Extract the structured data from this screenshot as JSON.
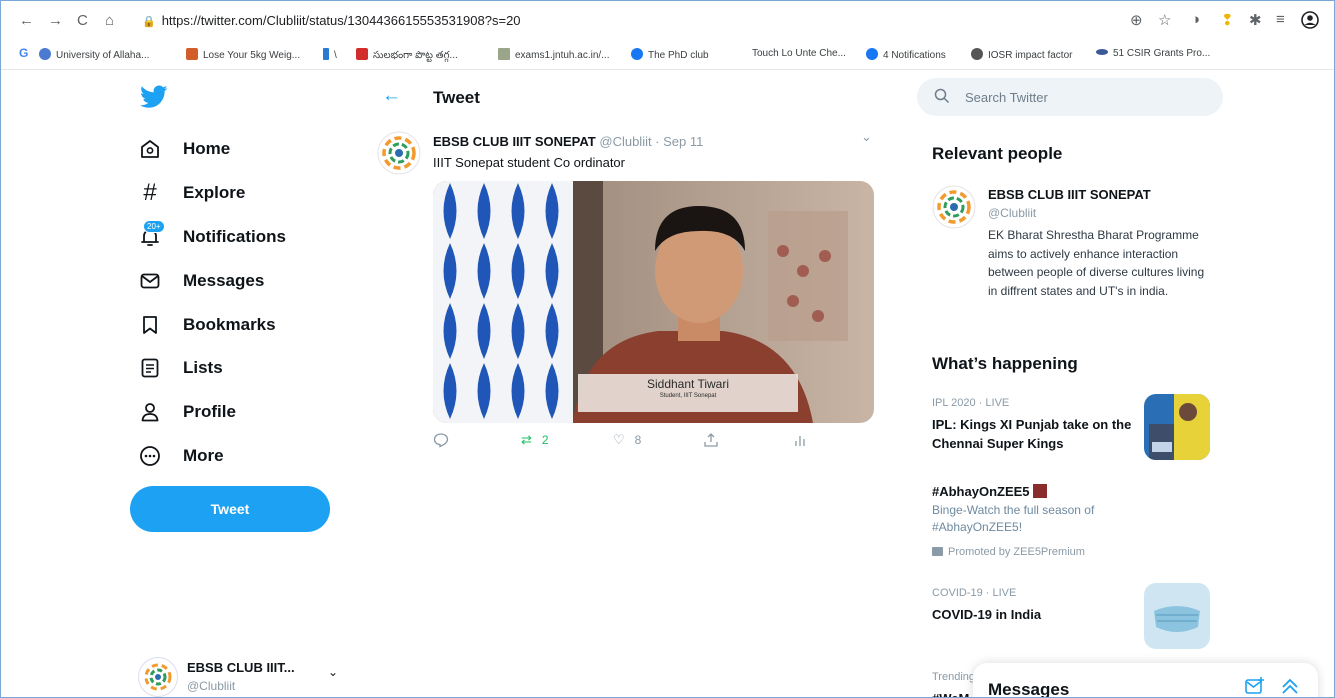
{
  "browser": {
    "url": "https://twitter.com/Clubliit/status/1304436615553531908?s=20",
    "bookmarks": [
      {
        "label": "University of Allaha...",
        "color": "#4a7bd1"
      },
      {
        "label": "Lose Your 5kg Weig...",
        "color": "#d35d2a"
      },
      {
        "label": "\\",
        "color": "#2a7ad1"
      },
      {
        "label": "సులభంగా పొట్ట తగ్గ...",
        "color": "#d22c2c"
      },
      {
        "label": "exams1.jntuh.ac.in/...",
        "color": "#9aa58a"
      },
      {
        "label": "The PhD club",
        "color": "#1877f2"
      },
      {
        "label": "Touch Lo Unte Che...",
        "color": "#ffffff"
      },
      {
        "label": "4 Notifications",
        "color": "#1877f2"
      },
      {
        "label": "IOSR impact factor",
        "color": "#555555"
      },
      {
        "label": "51 CSIR Grants Pro...",
        "color": "#3b5998"
      }
    ]
  },
  "nav": {
    "items": [
      {
        "label": "Home",
        "icon": "home-icon"
      },
      {
        "label": "Explore",
        "icon": "hashtag-icon"
      },
      {
        "label": "Notifications",
        "icon": "bell-icon",
        "badge": "20+"
      },
      {
        "label": "Messages",
        "icon": "envelope-icon"
      },
      {
        "label": "Bookmarks",
        "icon": "bookmark-icon"
      },
      {
        "label": "Lists",
        "icon": "list-icon"
      },
      {
        "label": "Profile",
        "icon": "person-icon"
      },
      {
        "label": "More",
        "icon": "more-icon"
      }
    ],
    "tweet_button": "Tweet",
    "account": {
      "name": "EBSB CLUB IIIT...",
      "handle": "@Clubliit"
    }
  },
  "main": {
    "page_title": "Tweet",
    "tweet": {
      "author": "EBSB CLUB IIIT SONEPAT",
      "meta": "@Clubliit · Sep 11",
      "text": "IIIT Sonepat student Co ordinator",
      "video_name": "Siddhant Tiwari",
      "video_role": "Student, IIIT Sonepat",
      "retweets": "2",
      "likes": "8"
    }
  },
  "sidebar": {
    "search_placeholder": "Search Twitter",
    "relevant_title": "Relevant people",
    "relevant": {
      "name": "EBSB CLUB IIIT SONEPAT",
      "handle": "@Clubliit",
      "bio": "EK Bharat Shrestha Bharat Programme aims to actively enhance interaction between people of diverse cultures living in diffrent states and UT's in india."
    },
    "happening_title": "What’s happening",
    "trends": [
      {
        "meta": "IPL 2020 · LIVE",
        "title": "IPL: Kings XI Punjab take on the Chennai Super Kings"
      },
      {
        "title": "#AbhayOnZEE5",
        "desc": "Binge-Watch the full season of #AbhayOnZEE5!",
        "promoted": "Promoted by ZEE5Premium"
      },
      {
        "meta": "COVID-19 · LIVE",
        "title": "COVID-19 in India"
      },
      {
        "meta": "Trending",
        "title": "#WeM"
      }
    ],
    "messages_dock": "Messages"
  }
}
